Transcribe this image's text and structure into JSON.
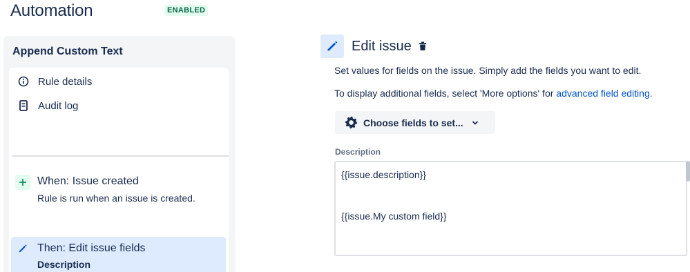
{
  "header": {
    "title": "Automation",
    "status": "ENABLED"
  },
  "rule": {
    "name": "Append Custom Text",
    "nav": [
      {
        "label": "Rule details",
        "icon": "info-icon"
      },
      {
        "label": "Audit log",
        "icon": "document-icon"
      }
    ],
    "trigger": {
      "title": "When: Issue created",
      "description": "Rule is run when an issue is created.",
      "icon": "plus-icon"
    },
    "action": {
      "title": "Then: Edit issue fields",
      "description": "Description",
      "icon": "pencil-icon"
    }
  },
  "editor": {
    "title": "Edit issue",
    "help_line1": "Set values for fields on the issue. Simply add the fields you want to edit.",
    "help_line2_prefix": "To display additional fields, select 'More options' for ",
    "help_line2_link": "advanced field editing",
    "help_line2_suffix": ".",
    "choose_button": "Choose fields to set...",
    "field_label": "Description",
    "field_value": "{{issue.description}}\n\n\n{{issue.My custom field}}"
  },
  "colors": {
    "accent": "#0052cc",
    "enabled_bg": "#e3fcef",
    "enabled_text": "#006644",
    "selected_bg": "#deebff"
  }
}
